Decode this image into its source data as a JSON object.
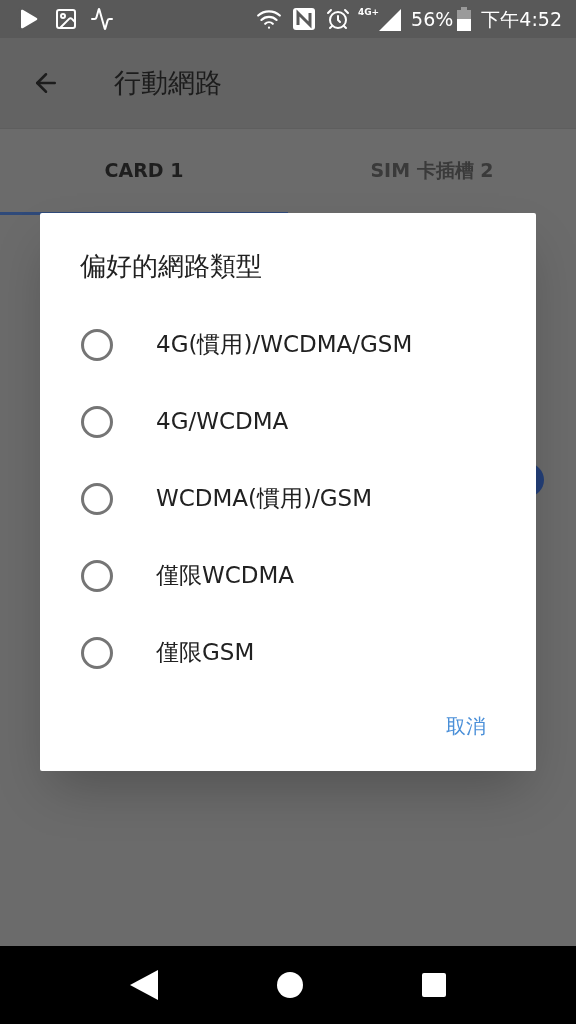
{
  "status_bar": {
    "network_label": "4G+",
    "battery": "56%",
    "time": "下午4:52"
  },
  "app_bar": {
    "title": "行動網路"
  },
  "tabs": [
    {
      "label": "CARD 1",
      "selected": true
    },
    {
      "label": "SIM 卡插槽 2",
      "selected": false
    }
  ],
  "background_switch": {
    "on": true
  },
  "dialog": {
    "title": "偏好的網路類型",
    "options": [
      {
        "label": "4G(慣用)/WCDMA/GSM",
        "selected": false
      },
      {
        "label": "4G/WCDMA",
        "selected": false
      },
      {
        "label": "WCDMA(慣用)/GSM",
        "selected": false
      },
      {
        "label": "僅限WCDMA",
        "selected": false
      },
      {
        "label": "僅限GSM",
        "selected": false
      }
    ],
    "cancel": "取消"
  }
}
